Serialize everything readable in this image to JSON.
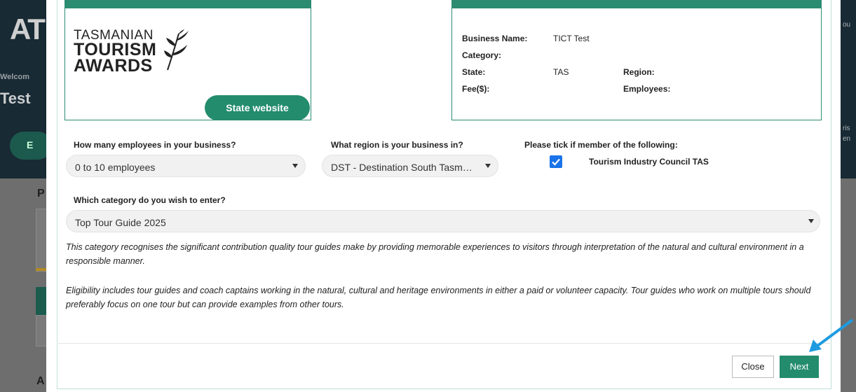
{
  "background": {
    "logo": "AT",
    "welcome": "Welcom",
    "user": "Test",
    "pill_label": "E",
    "section_p": "P",
    "section_a": "A",
    "right_top": "ou",
    "right_mid": "ris",
    "right_mid2": "en"
  },
  "logo": {
    "line1": "TASMANIAN",
    "line2": "TOURISM",
    "line3": "AWARDS"
  },
  "state_button": "State website",
  "business": {
    "name_label": "Business Name:",
    "name_value": "TICT Test",
    "category_label": "Category:",
    "category_value": "",
    "state_label": "State:",
    "state_value": "TAS",
    "region_label": "Region:",
    "region_value": "",
    "fee_label": "Fee($):",
    "fee_value": "",
    "employees_label": "Employees:",
    "employees_value": ""
  },
  "form": {
    "employees_question": "How many employees in your business?",
    "employees_selected": "0 to 10 employees",
    "region_question": "What region is your business in?",
    "region_selected": "DST - Destination South Tasm…",
    "member_question": "Please tick if member of the following:",
    "member_option": "Tourism Industry Council TAS",
    "member_checked": true,
    "category_question": "Which category do you wish to enter?",
    "category_selected": "Top Tour Guide 2025"
  },
  "description": {
    "para1": "This category recognises the significant contribution quality tour guides make by providing memorable experiences to visitors through interpretation of the natural and cultural environment in a responsible manner.",
    "para2": "Eligibility includes tour guides and coach captains working in the natural, cultural and heritage environments in either a paid or volunteer capacity. Tour guides who work on multiple tours should preferably focus on one tour but can provide examples from other tours."
  },
  "footer": {
    "close_label": "Close",
    "next_label": "Next"
  },
  "colors": {
    "accent": "#238c6d",
    "checkbox": "#1a73e8",
    "arrow": "#1e9be0"
  }
}
